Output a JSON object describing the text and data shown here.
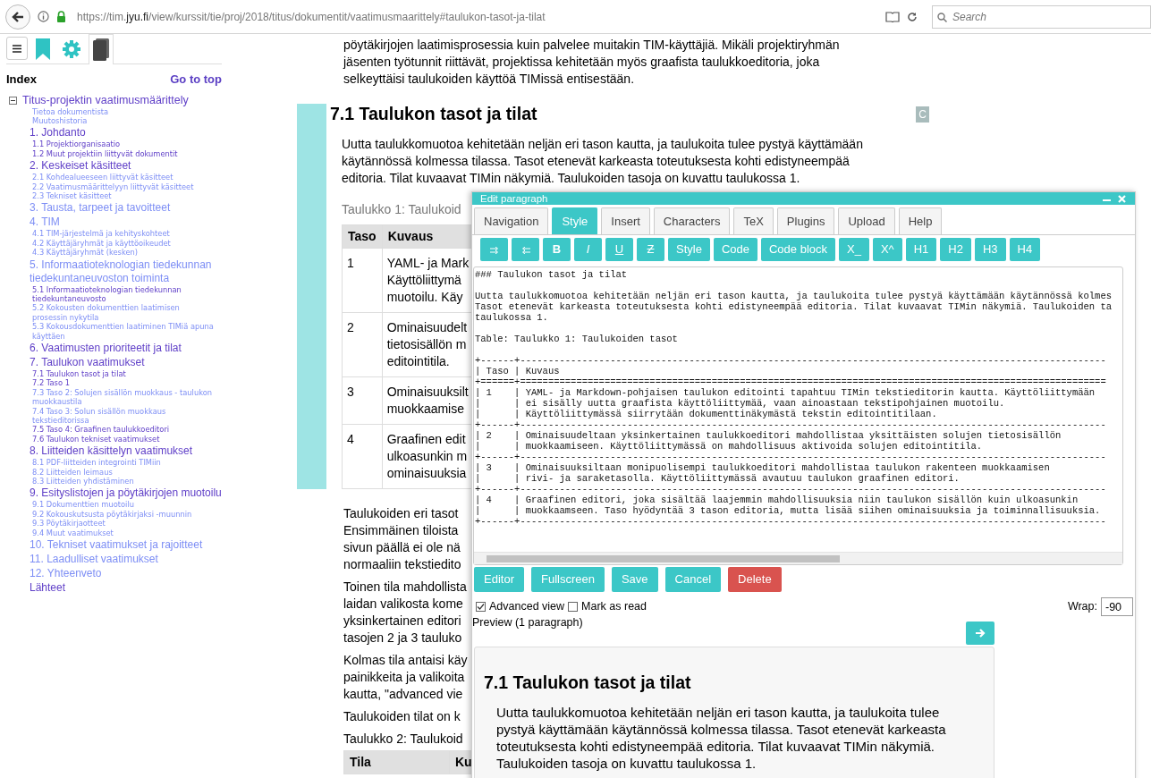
{
  "browser": {
    "url": "https://tim.**jyu.fi**/view/kurssit/tie/proj/2018/titus/dokumentit/vaatimusmaarittely#taulukon-tasot-ja-tilat",
    "search_placeholder": "Search"
  },
  "sidebar": {
    "tabs": [
      {
        "kind": "menu",
        "selected": false
      },
      {
        "kind": "bookmark",
        "selected": false
      },
      {
        "kind": "settings",
        "selected": false
      },
      {
        "kind": "index",
        "selected": true
      }
    ],
    "index_title": "Index",
    "go_to_top": "Go to top",
    "tree": [
      {
        "label": "Titus-projektin vaatimusmäärittely",
        "visited": true,
        "expanded": true,
        "children": [
          {
            "label": "Tietoa dokumentista",
            "kind": "entry",
            "visited": false
          },
          {
            "label": "Muutoshistoria",
            "kind": "entry",
            "visited": false
          },
          {
            "label": "1. Johdanto",
            "kind": "section",
            "visited": true,
            "children": [
              {
                "label": "1.1 Projektiorganisaatio",
                "visited": true
              },
              {
                "label": "1.2 Muut projektiin liittyvät dokumentit",
                "visited": true
              }
            ]
          },
          {
            "label": "2. Keskeiset käsitteet",
            "kind": "section",
            "visited": true,
            "children": [
              {
                "label": "2.1 Kohdealueeseen liittyvät käsitteet",
                "visited": false
              },
              {
                "label": "2.2 Vaatimusmäärittelyyn liittyvät käsitteet",
                "visited": false
              },
              {
                "label": "2.3 Tekniset käsitteet",
                "visited": false
              }
            ]
          },
          {
            "label": "3. Tausta, tarpeet ja tavoitteet",
            "kind": "section",
            "visited": false
          },
          {
            "label": "4. TIM",
            "kind": "section",
            "visited": false,
            "children": [
              {
                "label": "4.1 TIM-järjestelmä ja kehityskohteet",
                "visited": false
              },
              {
                "label": "4.2 Käyttäjäryhmät ja käyttöoikeudet",
                "visited": false
              },
              {
                "label": "4.3 Käyttäjäryhmät (kesken)",
                "visited": false
              }
            ]
          },
          {
            "label": "5. Informaatioteknologian tiedekunnan tiedekuntaneuvoston toiminta",
            "kind": "section",
            "visited": false,
            "children": [
              {
                "label": "5.1 Informaatioteknologian tiedekunnan tiedekuntaneuvosto",
                "visited": true
              },
              {
                "label": "5.2 Kokousten dokumenttien laatimisen prosessin nykytila",
                "visited": false
              },
              {
                "label": "5.3 Kokousdokumenttien laatiminen TIMiä apuna käyttäen",
                "visited": false
              }
            ]
          },
          {
            "label": "6. Vaatimusten prioriteetit ja tilat",
            "kind": "section",
            "visited": true
          },
          {
            "label": "7. Taulukon vaatimukset",
            "kind": "section",
            "visited": true,
            "children": [
              {
                "label": "7.1 Taulukon tasot ja tilat",
                "visited": true
              },
              {
                "label": "7.2 Taso 1",
                "visited": true
              },
              {
                "label": "7.3 Taso 2: Solujen sisällön muokkaus - taulukon muokkaustila",
                "visited": false
              },
              {
                "label": "7.4 Taso 3: Solun sisällön muokkaus tekstieditorissa",
                "visited": false
              },
              {
                "label": "7.5 Taso 4: Graafinen taulukkoeditori",
                "visited": true
              },
              {
                "label": "7.6 Taulukon tekniset vaatimukset",
                "visited": true
              }
            ]
          },
          {
            "label": "8. Liitteiden käsittelyn vaatimukset",
            "kind": "section",
            "visited": true,
            "children": [
              {
                "label": "8.1 PDF-liitteiden integrointi TIMiin",
                "visited": false
              },
              {
                "label": "8.2 Liitteiden leimaus",
                "visited": false
              },
              {
                "label": "8.3 Liitteiden yhdistäminen",
                "visited": false
              }
            ]
          },
          {
            "label": "9. Esityslistojen ja pöytäkirjojen muotoilu",
            "kind": "section",
            "visited": true,
            "children": [
              {
                "label": "9.1 Dokumenttien muotoilu",
                "visited": false
              },
              {
                "label": "9.2 Kokouskutsusta pöytäkirjaksi -muunnin",
                "visited": false
              },
              {
                "label": "9.3 Pöytäkirjaotteet",
                "visited": false
              },
              {
                "label": "9.4 Muut vaatimukset",
                "visited": false
              }
            ]
          },
          {
            "label": "10. Tekniset vaatimukset ja rajoitteet",
            "kind": "section",
            "visited": false
          },
          {
            "label": "11. Laadulliset vaatimukset",
            "kind": "section",
            "visited": false
          },
          {
            "label": "12. Yhteenveto",
            "kind": "section",
            "visited": false
          },
          {
            "label": "Lähteet",
            "kind": "section",
            "visited": true
          }
        ]
      }
    ]
  },
  "document": {
    "intro_lines": [
      "pöytäkirjojen laatimisprosessia kuin palvelee muitakin TIM-käyttäjiä. Mikäli projektiryhmän",
      "jäsenten työtunnit riittävät, projektissa kehitetään myös graafista taulukkoeditoria, joka",
      "selkeyttäisi taulukoiden käyttöä TIMissä entisestään."
    ],
    "heading": "7.1 Taulukon tasot ja tilat",
    "comment_button": "C",
    "lead_lines": [
      "Uutta taulukkomuotoa kehitetään neljän eri tason kautta, ja taulukoita tulee pystyä käyttämään",
      "käytännössä kolmessa tilassa. Tasot etenevät karkeasta toteutuksesta kohti edistyneempää",
      "editoria. Tilat kuvaavat TIMin näkymiä. Taulukoiden tasoja on kuvattu taulukossa 1."
    ],
    "table1": {
      "caption": "Taulukko 1: Taulukoid",
      "columns": [
        "Taso",
        "Kuvaus"
      ],
      "rows": [
        {
          "level": "1",
          "lines": [
            "YAML- ja Mark",
            "Käyttöliittymä",
            "muotoilu. Käy"
          ]
        },
        {
          "level": "2",
          "lines": [
            "Ominaisuudelt",
            "tietosisällön m",
            "editointitila."
          ]
        },
        {
          "level": "3",
          "lines": [
            "Ominaisuuksilt",
            "muokkaamise"
          ]
        },
        {
          "level": "4",
          "lines": [
            "Graafinen edit",
            "ulkoasunkin m",
            "ominaisuuksia"
          ]
        }
      ]
    },
    "after_paragraphs": [
      [
        "Taulukoiden eri tasot",
        "Ensimmäinen tiloista",
        "sivun päällä ei ole nä",
        "normaaliin tekstiedito"
      ],
      [
        "Toinen tila mahdollista",
        "laidan valikosta kome",
        "yksinkertainen editori",
        "tasojen 2 ja 3 tauluko"
      ],
      [
        "Kolmas tila antaisi käy",
        "painikkeita ja valikoita",
        "kautta, \"advanced vie"
      ],
      [
        "Taulukoiden tilat on k"
      ],
      [
        "Taulukko 2: Taulukoid"
      ]
    ],
    "table2": {
      "columns": [
        "Tila",
        "Ku"
      ]
    }
  },
  "dialog": {
    "title": "Edit paragraph",
    "tabs": [
      {
        "label": "Navigation",
        "selected": false
      },
      {
        "label": "Style",
        "selected": true
      },
      {
        "label": "Insert",
        "selected": false
      },
      {
        "label": "Characters",
        "selected": false
      },
      {
        "label": "TeX",
        "selected": false
      },
      {
        "label": "Plugins",
        "selected": false
      },
      {
        "label": "Upload",
        "selected": false
      },
      {
        "label": "Help",
        "selected": false
      }
    ],
    "toolbar": [
      {
        "kind": "indent"
      },
      {
        "kind": "outdent"
      },
      {
        "kind": "bold",
        "label": "B"
      },
      {
        "kind": "italic",
        "label": "I"
      },
      {
        "kind": "underline",
        "label": "U"
      },
      {
        "kind": "strike",
        "label": "Z"
      },
      {
        "kind": "text",
        "label": "Style"
      },
      {
        "kind": "text",
        "label": "Code"
      },
      {
        "kind": "text",
        "label": "Code block"
      },
      {
        "kind": "text",
        "label": "X_"
      },
      {
        "kind": "text",
        "label": "X^"
      },
      {
        "kind": "text",
        "label": "H1"
      },
      {
        "kind": "text",
        "label": "H2"
      },
      {
        "kind": "text",
        "label": "H3"
      },
      {
        "kind": "text",
        "label": "H4"
      }
    ],
    "source_text": [
      "### Taulukon tasot ja tilat\n\nUutta taulukkomuotoa kehitetään neljän eri tason kautta, ja taulukoita tulee pystyä käyttämään käytännössä kolmes",
      "Tasot etenevät karkeasta toteutuksesta kohti edistyneempää editoria. Tilat kuvaavat TIMin näkymiä. Taulukoiden ta\ntaulukossa 1.\n\nTable: Taulukko 1: Taulukoiden tasot\n",
      "+------+--------------------------------------------------------------------------------------------------------",
      "| Taso | Kuvaus",
      "+======+========================================================================================================",
      "| 1    | YAML- ja Markdown-pohjaisen taulukon editointi tapahtuu TIMin tekstieditorin kautta. Käyttöliittymään",
      "|      | ei sisälly uutta graafista käyttöliittymää, vaan ainoastaan tekstipohjainen muotoilu.",
      "|      | Käyttöliittymässä siirrytään dokumenttinäkymästä tekstin editointitilaan.",
      "+------+--------------------------------------------------------------------------------------------------------",
      "| 2    | Ominaisuudeltaan yksinkertainen taulukkoeditori mahdollistaa yksittäisten solujen tietosisällön",
      "|      | muokkaamiseen. Käyttöliittymässä on mahdollisuus aktivoida solujen editointitila.",
      "+------+--------------------------------------------------------------------------------------------------------",
      "| 3    | Ominaisuuksiltaan monipuolisempi taulukkoeditori mahdollistaa taulukon rakenteen muokkaamisen",
      "|      | rivi- ja saraketasolla. Käyttöliittymässä avautuu taulukon graafinen editori.",
      "+------+--------------------------------------------------------------------------------------------------------",
      "| 4    | Graafinen editori, joka sisältää laajemmin mahdollisuuksia niin taulukon sisällön kuin ulkoasunkin",
      "|      | muokkaamseen. Taso hyödyntää 3 tason editoria, mutta lisää siihen ominaisuuksia ja toiminnallisuuksia.",
      "+------+--------------------------------------------------------------------------------------------------------"
    ],
    "actions": [
      {
        "label": "Editor",
        "kind": "primary"
      },
      {
        "label": "Fullscreen",
        "kind": "primary"
      },
      {
        "label": "Save",
        "kind": "primary"
      },
      {
        "label": "Cancel",
        "kind": "primary"
      },
      {
        "label": "Delete",
        "kind": "danger"
      }
    ],
    "options": [
      {
        "label": "Advanced view",
        "checked": true
      },
      {
        "label": "Mark as read",
        "checked": false
      }
    ],
    "wrap": {
      "label": "Wrap:",
      "value": "-90"
    },
    "preview": {
      "label": "Preview (1 paragraph)",
      "heading": "7.1 Taulukon tasot ja tilat",
      "text": "Uutta taulukkomuotoa kehitetään neljän eri tason kautta, ja taulukoita tulee pystyä käyttämään käytännössä kolmessa tilassa. Tasot etenevät karkeasta toteutuksesta kohti edistyneempää editoria. Tilat kuvaavat TIMin näkymiä. Taulukoiden tasoja on kuvattu taulukossa 1."
    }
  }
}
